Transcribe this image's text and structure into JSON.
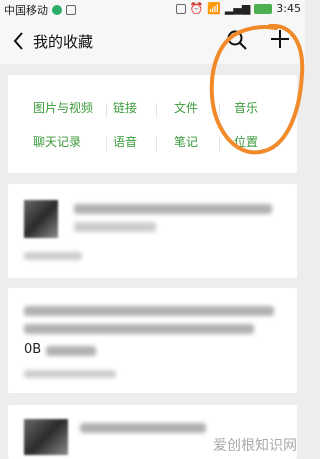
{
  "status_bar": {
    "carrier": "中国移动",
    "time": "3:45",
    "icons": [
      "green-dot-icon",
      "message-icon",
      "vibrate-icon",
      "alarm-icon",
      "wifi-icon",
      "signal-4g-icon",
      "battery-icon"
    ]
  },
  "header": {
    "title": "我的收藏",
    "icons": [
      "back-arrow-icon",
      "search-icon",
      "plus-icon"
    ]
  },
  "categories": {
    "row1": [
      "图片与视频",
      "链接",
      "文件",
      "音乐"
    ],
    "row2": [
      "聊天记录",
      "语音",
      "笔记",
      "位置"
    ]
  },
  "cards": [
    {
      "title_blurred": true,
      "meta_blurred": true
    },
    {
      "visible_text": "0B"
    },
    {
      "title_blurred": true
    }
  ],
  "colors": {
    "category_green": "#3b9a3b",
    "annotation_orange": "#f08a2a",
    "background": "#ededed"
  },
  "watermark": "爱创根知识网"
}
